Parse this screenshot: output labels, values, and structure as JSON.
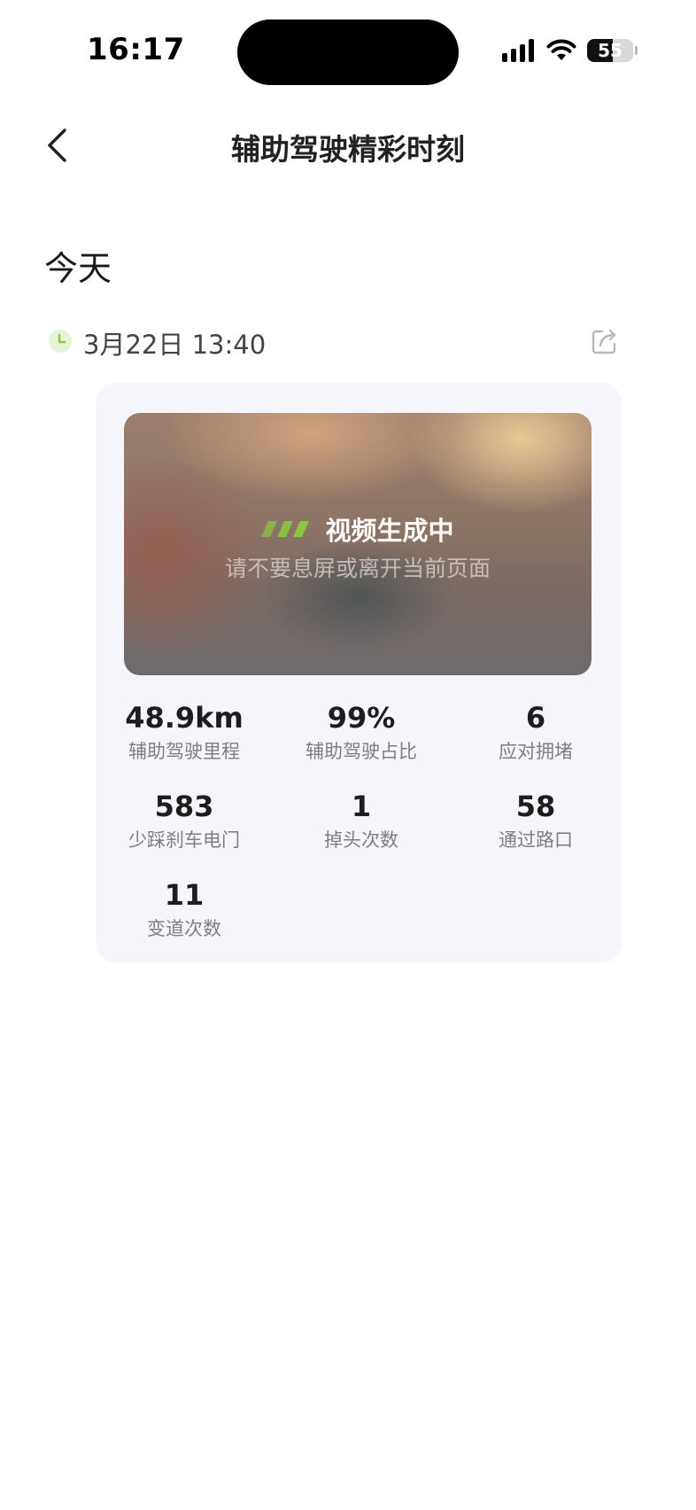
{
  "status_bar": {
    "time": "16:17",
    "battery_level": "55",
    "battery_fraction": 0.55
  },
  "nav": {
    "title": "辅助驾驶精彩时刻"
  },
  "section": {
    "title": "今天"
  },
  "record": {
    "datetime": "3月22日 13:40",
    "video": {
      "status": "视频生成中",
      "hint": "请不要息屏或离开当前页面"
    },
    "stats": [
      {
        "value": "48.9km",
        "label": "辅助驾驶里程"
      },
      {
        "value": "99%",
        "label": "辅助驾驶占比"
      },
      {
        "value": "6",
        "label": "应对拥堵"
      },
      {
        "value": "583",
        "label": "少踩刹车电门"
      },
      {
        "value": "1",
        "label": "掉头次数"
      },
      {
        "value": "58",
        "label": "通过路口"
      },
      {
        "value": "11",
        "label": "变道次数"
      }
    ]
  },
  "colors": {
    "accent_green": "#8cc63f",
    "card_background": "#f5f6fb",
    "label_gray": "#7c7f86"
  }
}
